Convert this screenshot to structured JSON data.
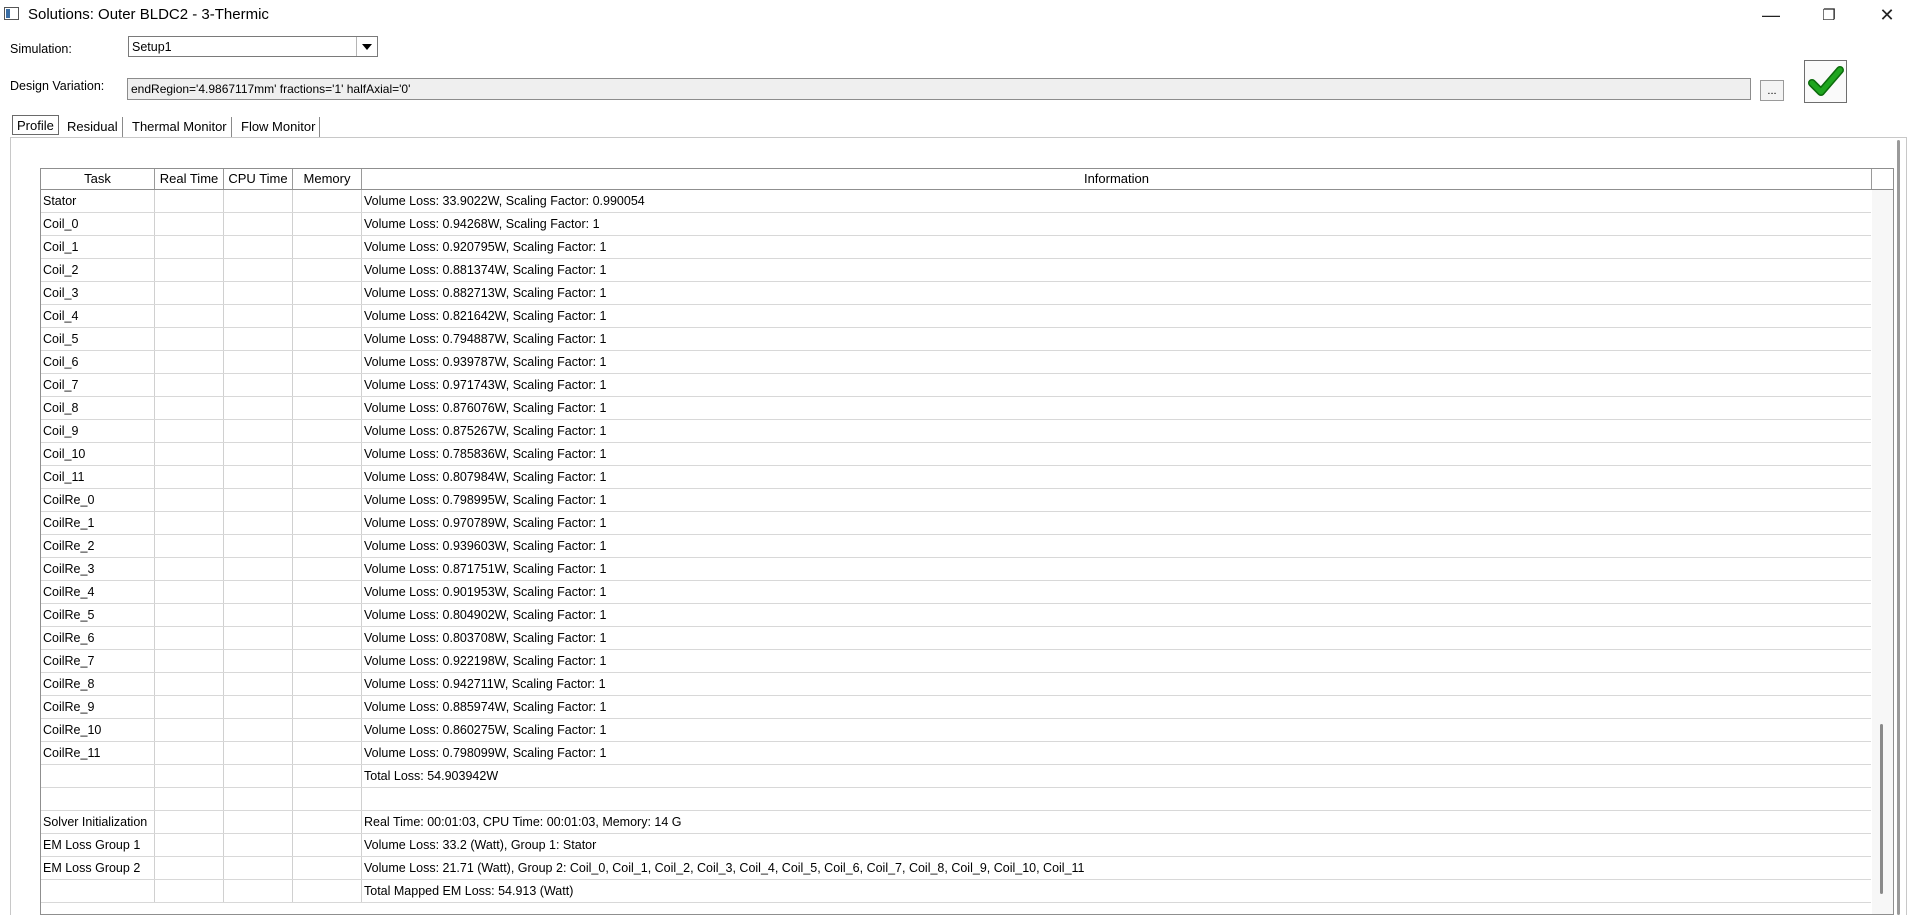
{
  "window": {
    "title": "Solutions: Outer BLDC2 - 3-Thermic",
    "minimize_glyph": "—",
    "restore_glyph": "❐",
    "close_glyph": "✕"
  },
  "simulation": {
    "label": "Simulation:",
    "value": "Setup1"
  },
  "design_variation": {
    "label": "Design Variation:",
    "value": "endRegion='4.9867117mm' fractions='1' halfAxial='0'",
    "browse_label": "..."
  },
  "tabs": [
    {
      "label": "Profile",
      "active": true
    },
    {
      "label": "Residual",
      "active": false
    },
    {
      "label": "Thermal Monitor",
      "active": false
    },
    {
      "label": "Flow Monitor",
      "active": false
    }
  ],
  "table": {
    "columns": [
      "Task",
      "Real Time",
      "CPU Time",
      "Memory",
      "Information"
    ],
    "rows": [
      {
        "task": "Stator",
        "info": "Volume Loss: 33.9022W, Scaling Factor: 0.990054"
      },
      {
        "task": "Coil_0",
        "info": "Volume Loss: 0.94268W, Scaling Factor: 1"
      },
      {
        "task": "Coil_1",
        "info": "Volume Loss: 0.920795W, Scaling Factor: 1"
      },
      {
        "task": "Coil_2",
        "info": "Volume Loss: 0.881374W, Scaling Factor: 1"
      },
      {
        "task": "Coil_3",
        "info": "Volume Loss: 0.882713W, Scaling Factor: 1"
      },
      {
        "task": "Coil_4",
        "info": "Volume Loss: 0.821642W, Scaling Factor: 1"
      },
      {
        "task": "Coil_5",
        "info": "Volume Loss: 0.794887W, Scaling Factor: 1"
      },
      {
        "task": "Coil_6",
        "info": "Volume Loss: 0.939787W, Scaling Factor: 1"
      },
      {
        "task": "Coil_7",
        "info": "Volume Loss: 0.971743W, Scaling Factor: 1"
      },
      {
        "task": "Coil_8",
        "info": "Volume Loss: 0.876076W, Scaling Factor: 1"
      },
      {
        "task": "Coil_9",
        "info": "Volume Loss: 0.875267W, Scaling Factor: 1"
      },
      {
        "task": "Coil_10",
        "info": "Volume Loss: 0.785836W, Scaling Factor: 1"
      },
      {
        "task": "Coil_11",
        "info": "Volume Loss: 0.807984W, Scaling Factor: 1"
      },
      {
        "task": "CoilRe_0",
        "info": "Volume Loss: 0.798995W, Scaling Factor: 1"
      },
      {
        "task": "CoilRe_1",
        "info": "Volume Loss: 0.970789W, Scaling Factor: 1"
      },
      {
        "task": "CoilRe_2",
        "info": "Volume Loss: 0.939603W, Scaling Factor: 1"
      },
      {
        "task": "CoilRe_3",
        "info": "Volume Loss: 0.871751W, Scaling Factor: 1"
      },
      {
        "task": "CoilRe_4",
        "info": "Volume Loss: 0.901953W, Scaling Factor: 1"
      },
      {
        "task": "CoilRe_5",
        "info": "Volume Loss: 0.804902W, Scaling Factor: 1"
      },
      {
        "task": "CoilRe_6",
        "info": "Volume Loss: 0.803708W, Scaling Factor: 1"
      },
      {
        "task": "CoilRe_7",
        "info": "Volume Loss: 0.922198W, Scaling Factor: 1"
      },
      {
        "task": "CoilRe_8",
        "info": "Volume Loss: 0.942711W, Scaling Factor: 1"
      },
      {
        "task": "CoilRe_9",
        "info": "Volume Loss: 0.885974W, Scaling Factor: 1"
      },
      {
        "task": "CoilRe_10",
        "info": "Volume Loss: 0.860275W, Scaling Factor: 1"
      },
      {
        "task": "CoilRe_11",
        "info": "Volume Loss: 0.798099W, Scaling Factor: 1"
      },
      {
        "task": "",
        "info": "Total Loss: 54.903942W"
      },
      {
        "task": "",
        "info": ""
      },
      {
        "task": "Solver Initialization",
        "info": "Real Time: 00:01:03, CPU Time: 00:01:03, Memory: 14 G"
      },
      {
        "task": "EM Loss Group 1",
        "info": "Volume Loss: 33.2 (Watt), Group 1: Stator"
      },
      {
        "task": "EM Loss Group 2",
        "info": "Volume Loss: 21.71 (Watt), Group 2: Coil_0, Coil_1, Coil_2, Coil_3, Coil_4, Coil_5, Coil_6, Coil_7, Coil_8, Coil_9, Coil_10, Coil_11"
      },
      {
        "task": "",
        "info": "Total Mapped EM Loss: 54.913 (Watt)"
      }
    ]
  },
  "colors": {
    "ok_check": "#1fa51f",
    "field_bg": "#efefef"
  }
}
